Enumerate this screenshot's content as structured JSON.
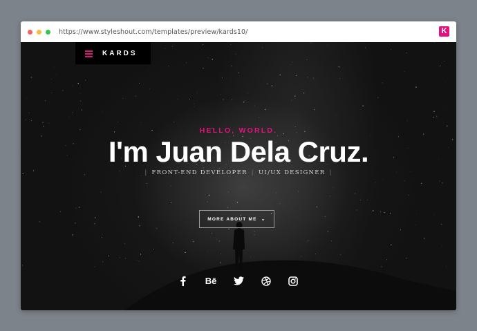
{
  "browser": {
    "url": "https://www.styleshout.com/templates/preview/kards10/",
    "favicon_letter": "K",
    "dot_colors": [
      "#fc605c",
      "#fdbc40",
      "#34c84a"
    ]
  },
  "nav": {
    "brand": "KARDS",
    "menu_icon": "hamburger-menu-icon"
  },
  "hero": {
    "greeting": "HELLO, WORLD.",
    "headline": "I'm Juan Dela Cruz.",
    "role_1": "FRONT-END DEVELOPER",
    "role_2": "UI/UX DESIGNER",
    "separator": "|",
    "cta_label": "MORE ABOUT ME",
    "cta_chevron": "⌄"
  },
  "social": {
    "icons": [
      "facebook-icon",
      "behance-icon",
      "twitter-icon",
      "dribbble-icon",
      "instagram-icon"
    ],
    "behance_text": "Bē"
  },
  "colors": {
    "accent": "#e5127d",
    "background": "#121212"
  }
}
